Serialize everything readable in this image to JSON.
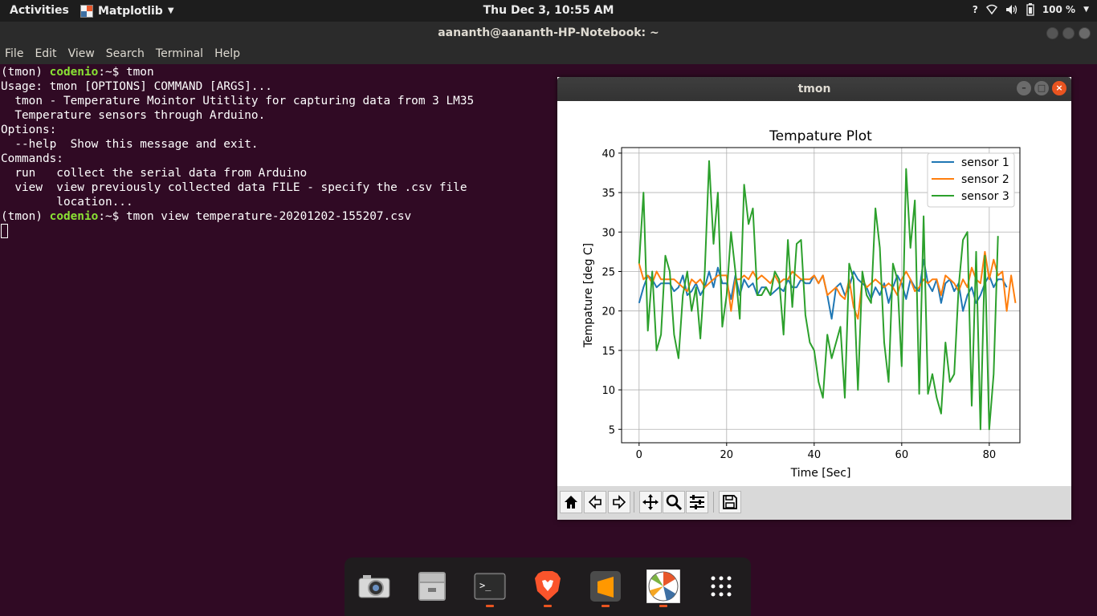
{
  "topbar": {
    "activities": "Activities",
    "app_menu": "Matplotlib",
    "clock": "Thu Dec  3, 10:55 AM",
    "battery": "100 %"
  },
  "terminal": {
    "title": "aananth@aananth-HP-Notebook: ~",
    "menu": [
      "File",
      "Edit",
      "View",
      "Search",
      "Terminal",
      "Help"
    ],
    "lines": [
      {
        "prefix": "(tmon) ",
        "host": "codenio",
        "rest": ":~$ tmon"
      },
      {
        "text": "Usage: tmon [OPTIONS] COMMAND [ARGS]..."
      },
      {
        "text": ""
      },
      {
        "text": "  tmon - Temperature Mointor Utitlity for capturing data from 3 LM35"
      },
      {
        "text": "  Temperature sensors through Arduino."
      },
      {
        "text": ""
      },
      {
        "text": "Options:"
      },
      {
        "text": "  --help  Show this message and exit."
      },
      {
        "text": ""
      },
      {
        "text": "Commands:"
      },
      {
        "text": "  run   collect the serial data from Arduino"
      },
      {
        "text": "  view  view previously collected data FILE - specify the .csv file"
      },
      {
        "text": "        location..."
      },
      {
        "prefix": "(tmon) ",
        "host": "codenio",
        "rest": ":~$ tmon view temperature-20201202-155207.csv"
      }
    ]
  },
  "figure_window": {
    "title": "tmon"
  },
  "chart_data": {
    "type": "line",
    "title": "Tempature Plot",
    "xlabel": "Time [Sec]",
    "ylabel": "Tempature [deg C]",
    "xlim": [
      -4,
      87
    ],
    "ylim": [
      3.3,
      40.7
    ],
    "xticks": [
      0,
      20,
      40,
      60,
      80
    ],
    "yticks": [
      5,
      10,
      15,
      20,
      25,
      30,
      35,
      40
    ],
    "grid": true,
    "legend_position": "top-right",
    "series": [
      {
        "name": "sensor 1",
        "color": "#1f77b4",
        "values": [
          21,
          23,
          24.5,
          24,
          23,
          23.5,
          23.5,
          23.5,
          22.5,
          23,
          24.5,
          22,
          22.5,
          23.5,
          22,
          23,
          25,
          23,
          25.5,
          23.5,
          23.5,
          21.5,
          24.5,
          22,
          24,
          23,
          23.5,
          22,
          23,
          23,
          22,
          22.5,
          23,
          22.5,
          24,
          23,
          23,
          24,
          23.5,
          23.5,
          24.5,
          23.5,
          24.5,
          22,
          19,
          23,
          23.5,
          22,
          23,
          25,
          24,
          23.5,
          23,
          21.5,
          23,
          22,
          23.5,
          21,
          23,
          24.5,
          23.5,
          21.5,
          24,
          23,
          22.5,
          26.5,
          23.5,
          22.5,
          24,
          21,
          23.5,
          24,
          22.5,
          23.5,
          20,
          22,
          23,
          21,
          22,
          23.5,
          24.5,
          23,
          24,
          24,
          23
        ]
      },
      {
        "name": "sensor 2",
        "color": "#ff7f0e",
        "values": [
          26,
          24,
          24.5,
          23.5,
          25,
          24,
          24,
          24,
          24,
          23.5,
          23,
          22.5,
          24,
          23.5,
          24,
          23,
          23.5,
          24,
          24.5,
          24.5,
          24.5,
          20,
          24,
          24,
          24.5,
          24,
          25,
          24,
          24.5,
          24,
          23.5,
          24.5,
          23.5,
          24,
          24,
          25,
          24.5,
          24,
          24,
          24,
          24.5,
          23.5,
          24.5,
          22,
          22.5,
          23,
          22,
          21.5,
          24,
          20.5,
          19,
          24,
          23,
          23.5,
          24,
          23.5,
          23,
          23.5,
          23,
          22,
          24,
          25,
          24,
          22.5,
          23,
          24,
          23.5,
          24,
          24,
          22,
          24.5,
          24,
          23.5,
          22.5,
          24,
          23,
          25.5,
          24,
          23.5,
          27.5,
          24,
          26.5,
          24.5,
          25,
          20,
          24.5,
          21
        ]
      },
      {
        "name": "sensor 3",
        "color": "#2ca02c",
        "values": [
          26,
          35,
          17.5,
          25,
          15,
          17,
          27,
          25,
          17,
          14,
          22,
          25,
          20,
          23,
          16.5,
          25,
          39,
          28.5,
          35,
          18,
          22,
          30,
          25,
          19,
          36,
          31,
          33,
          22,
          22,
          23,
          22,
          25,
          24,
          17,
          29,
          20.5,
          28.5,
          29,
          19.5,
          16,
          15,
          11,
          9,
          17,
          14,
          16,
          18,
          9,
          26,
          24,
          10,
          25,
          22,
          21,
          33,
          28,
          16,
          11,
          26,
          24,
          13,
          38,
          28,
          34,
          9.5,
          32,
          9.5,
          12,
          9,
          7,
          16,
          11,
          12,
          23,
          29,
          30,
          8,
          27.5,
          5,
          27,
          5,
          12,
          29.5
        ]
      }
    ]
  },
  "toolbar": {
    "buttons": [
      "home-icon",
      "back-icon",
      "forward-icon",
      "pan-icon",
      "zoom-icon",
      "configure-subplots-icon",
      "save-icon"
    ]
  },
  "dock": {
    "apps": [
      "camera-icon",
      "files-icon",
      "terminal-icon",
      "brave-browser-icon",
      "sublime-text-icon",
      "matplotlib-icon",
      "show-applications-icon"
    ]
  }
}
